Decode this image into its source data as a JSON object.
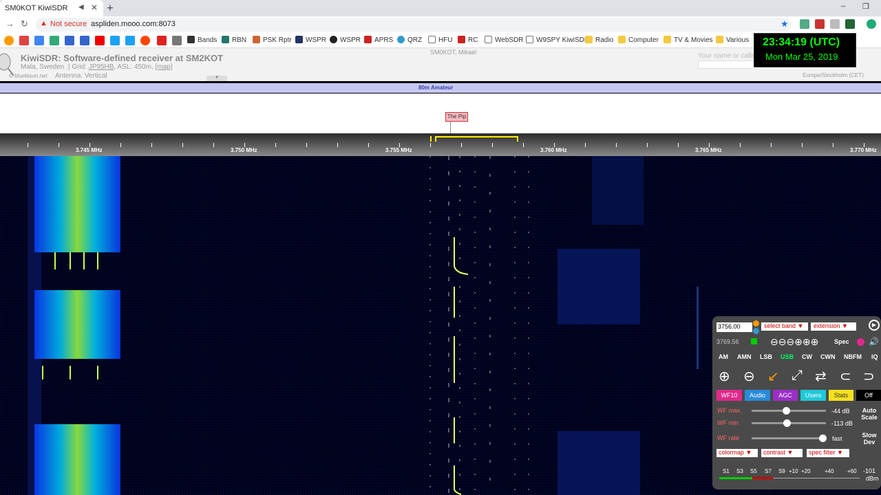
{
  "browser": {
    "tab_title": "SM0KOT KiwiSDR",
    "new_tab_label": "+",
    "not_secure_label": "Not secure",
    "url": "aspliden.mooo.com:8073",
    "bookmarks": [
      "Bands",
      "RBN",
      "PSK Rptr",
      "WSPR",
      "WSPR",
      "APRS",
      "QRZ",
      "HFU",
      "RC",
      "WebSDR",
      "W9SPY KiwiSDR",
      "Radio",
      "Computer",
      "TV & Movies",
      "Various"
    ]
  },
  "kiwi": {
    "title": "KiwiSDR: Software-defined receiver at SM2KOT",
    "location": "Mala, Sweden",
    "grid_label": "Grid:",
    "grid": "JP95HB",
    "asl": "ASL: 450m,",
    "map_link": "[map]",
    "copyright": "© bluebison.net",
    "antenna": "Antenna: Vertical",
    "owner": "SM0KOT, Mikael",
    "callsign_placeholder": "Your name or calls",
    "timezone": "Europe/Stockholm (CET)"
  },
  "clock": {
    "time": "23:34:19 (UTC)",
    "date": "Mon Mar 25, 2019"
  },
  "band": {
    "name": "80m Amateur"
  },
  "dx_labels": [
    {
      "text": "The Pip"
    }
  ],
  "scale_labels": [
    "3.745 MHz",
    "3.750 MHz",
    "3.755 MHz",
    "3.760 MHz",
    "3.765 MHz",
    "3.770 MHz"
  ],
  "panel": {
    "freq": "3756.00",
    "select_band": "select band ▼",
    "extension": "extension ▼",
    "freq_readout": "3769.56",
    "zoom_buttons": "⊖⊖⊖⊕⊕⊕",
    "spec_label": "Spec",
    "modes": [
      "AM",
      "AMN",
      "LSB",
      "USB",
      "CW",
      "CWN",
      "NBFM",
      "IQ"
    ],
    "active_mode": "USB",
    "tabs": [
      "WF10",
      "Audio",
      "AGC",
      "Users",
      "Stats",
      "Off"
    ],
    "wf_max_label": "WF max",
    "wf_max_value": "-44 dB",
    "wf_min_label": "WF min",
    "wf_min_value": "-113 dB",
    "wf_rate_label": "WF rate",
    "wf_rate_value": "fast",
    "auto_scale": "Auto Scale",
    "slow_dev": "Slow Dev",
    "colormap": "colormap ▼",
    "contrast": "contrast ▼",
    "spec_filter": "spec filter ▼",
    "smeter_labels": [
      "S1",
      "S3",
      "S5",
      "S7",
      "S9",
      "+10",
      "+20",
      "+40",
      "+60"
    ],
    "smeter_value": "-101",
    "smeter_unit": "dBm",
    "wf_max_fraction": 0.46,
    "wf_min_fraction": 0.47,
    "wf_rate_fraction": 0.95
  },
  "colors": {
    "clock": "#00ff00",
    "band": "#c6c8f0",
    "passband": "#ffee00",
    "active_mode": "#00ff66"
  }
}
